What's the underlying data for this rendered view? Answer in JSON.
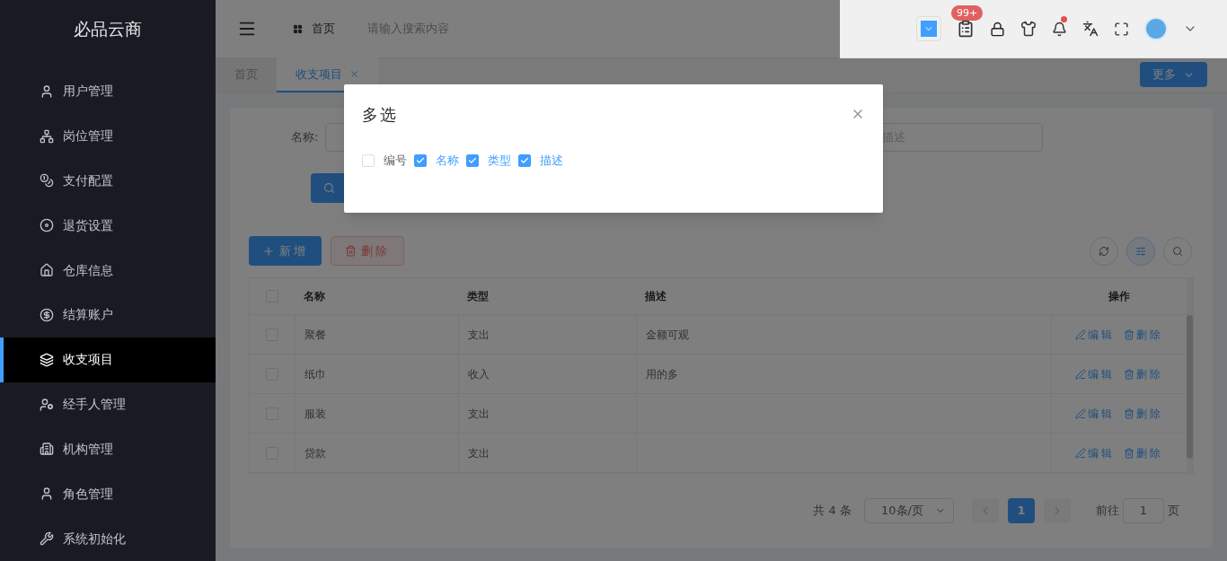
{
  "sidebar": {
    "logo": "必品云商",
    "items": [
      {
        "label": "用户管理",
        "selected": false
      },
      {
        "label": "岗位管理",
        "selected": false
      },
      {
        "label": "支付配置",
        "selected": false
      },
      {
        "label": "退货设置",
        "selected": false
      },
      {
        "label": "仓库信息",
        "selected": false
      },
      {
        "label": "结算账户",
        "selected": false
      },
      {
        "label": "收支项目",
        "selected": true
      },
      {
        "label": "经手人管理",
        "selected": false
      },
      {
        "label": "机构管理",
        "selected": false
      },
      {
        "label": "角色管理",
        "selected": false
      },
      {
        "label": "系统初始化",
        "selected": false
      }
    ]
  },
  "header": {
    "breadcrumb": "首页",
    "search": {
      "placeholder": "请输入搜索内容"
    },
    "badge": "99+",
    "bell_unread": true
  },
  "tabs": [
    {
      "label": "首页",
      "selected": false,
      "closable": false
    },
    {
      "label": "收支项目",
      "selected": true,
      "closable": true
    }
  ],
  "more_button": "更多",
  "filter": {
    "name_label": "名称:",
    "description_placeholder": "描述"
  },
  "toolbar": [
    {
      "label": "新增",
      "kind": "primary"
    },
    {
      "label": "删除",
      "kind": "danger"
    }
  ],
  "table": {
    "all_checked": false,
    "columns": [
      "名称",
      "类型",
      "描述",
      "操作"
    ],
    "rows": [
      {
        "checked": false,
        "cells": [
          "聚餐",
          "支出",
          "金额可观"
        ],
        "actions": [
          "编辑",
          "删除"
        ]
      },
      {
        "checked": false,
        "cells": [
          "纸巾",
          "收入",
          "用的多"
        ],
        "actions": [
          "编辑",
          "删除"
        ]
      },
      {
        "checked": false,
        "cells": [
          "服装",
          "支出",
          ""
        ],
        "actions": [
          "编辑",
          "删除"
        ]
      },
      {
        "checked": false,
        "cells": [
          "贷款",
          "支出",
          ""
        ],
        "actions": [
          "编辑",
          "删除"
        ]
      }
    ]
  },
  "pagination": {
    "total": "共 4 条",
    "page_size": "10条/页",
    "pages": [
      {
        "label": "1",
        "selected": true
      }
    ],
    "goto_label": "前往",
    "goto_value": "1",
    "page_suffix": "页"
  },
  "dialog": {
    "title": "多选",
    "options": [
      {
        "label": "编号",
        "checked": false
      },
      {
        "label": "名称",
        "checked": true
      },
      {
        "label": "类型",
        "checked": true
      },
      {
        "label": "描述",
        "checked": true
      }
    ]
  }
}
